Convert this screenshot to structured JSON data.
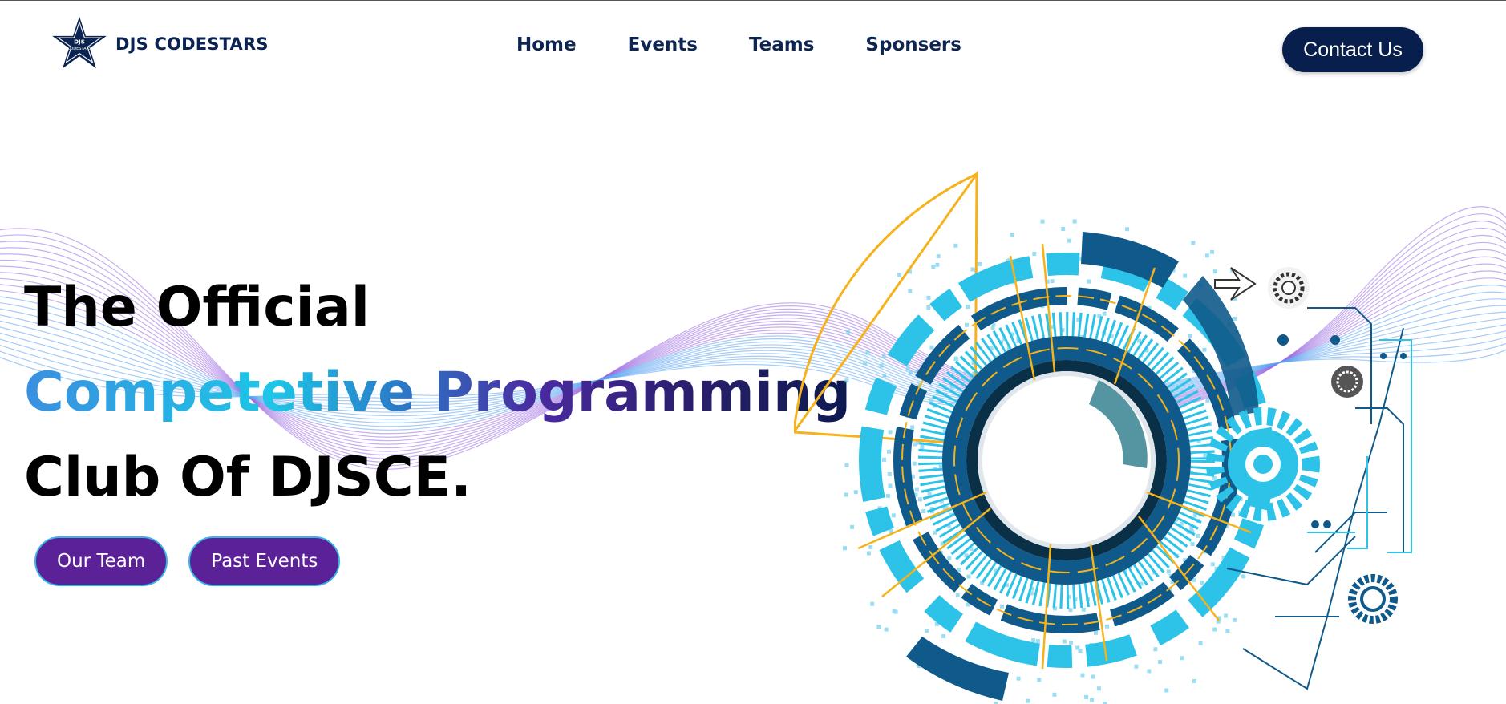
{
  "nav": {
    "brand": "DJS CODESTARS",
    "logo_text_top": "DJS",
    "logo_text_bottom": "CODESTARS",
    "links": [
      "Home",
      "Events",
      "Teams",
      "Sponsers"
    ],
    "contact_label": "Contact Us"
  },
  "hero": {
    "line1": "The Official",
    "line2": "Competetive Programming",
    "line3": "Club Of DJSCE.",
    "buttons": [
      "Our Team",
      "Past Events"
    ]
  },
  "colors": {
    "navy": "#081f4d",
    "purple_button": "#5b2298",
    "button_border": "#3ab3e8",
    "cyan": "#2dc3e8",
    "dark_blue": "#0f5a8a",
    "gold": "#f5b21a"
  },
  "icons": [
    "star-logo-icon",
    "arrow-right-icon",
    "gear-icon"
  ]
}
